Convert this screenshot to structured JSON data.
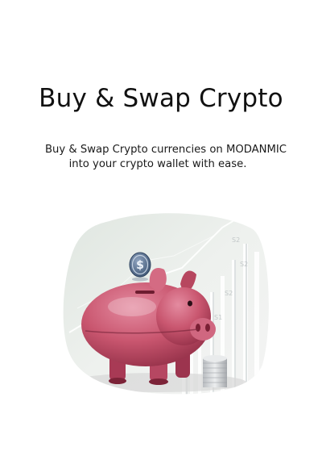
{
  "hero": {
    "title": "Buy & Swap Crypto",
    "description_line1": "Buy & Swap Crypto currencies on MODANMIC",
    "description_line2": "into your crypto wallet with ease."
  },
  "illustration": {
    "subject": "piggy-bank-with-dollar-coin",
    "coin_symbol": "$",
    "colors": {
      "pig": "#c9566f",
      "pig_shadow": "#8e2c44",
      "coin": "#5b7394",
      "background_tint": "#e8ede8"
    }
  }
}
